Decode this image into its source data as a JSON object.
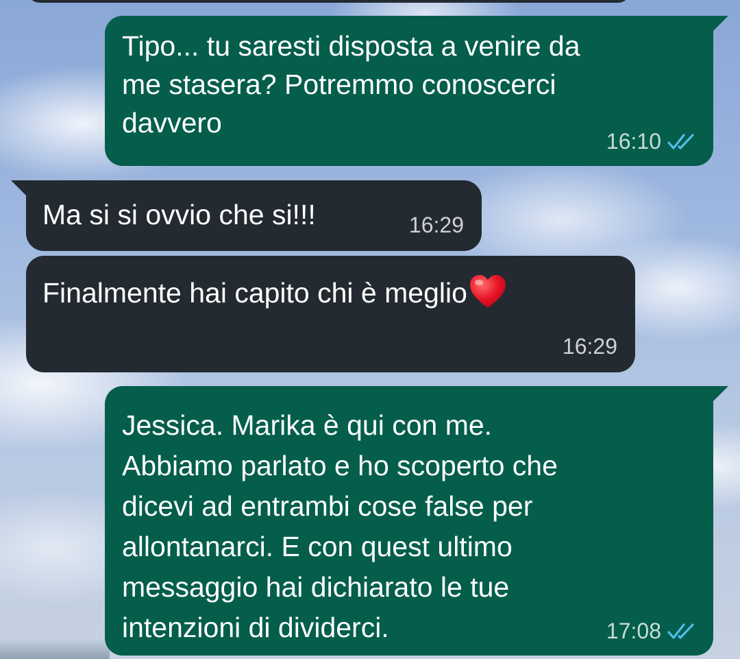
{
  "chat": {
    "messages": [
      {
        "direction": "outgoing",
        "text": "Tipo... tu saresti disposta a venire da\nme stasera? Potremmo conoscerci\ndavvero",
        "time": "16:10",
        "status": "read",
        "status_icon": "double-check-icon"
      },
      {
        "direction": "incoming",
        "text": "Ma si si ovvio che si!!!",
        "time": "16:29"
      },
      {
        "direction": "incoming",
        "text": "Finalmente hai capito chi è meglio",
        "emoji": "heart-emoji",
        "time": "16:29"
      },
      {
        "direction": "outgoing",
        "text": "Jessica. Marika è qui con me.\nAbbiamo parlato e ho scoperto che\ndicevi ad entrambi cose false per\nallontanarci. E con quest ultimo\nmessaggio hai dichiarato le tue\nintenzioni di dividerci.",
        "time": "17:08",
        "status": "read",
        "status_icon": "double-check-icon"
      }
    ]
  },
  "colors": {
    "outgoing_bubble": "#055e4c",
    "incoming_bubble": "#232a31",
    "read_ticks": "#53bdeb",
    "text": "#ffffff"
  }
}
